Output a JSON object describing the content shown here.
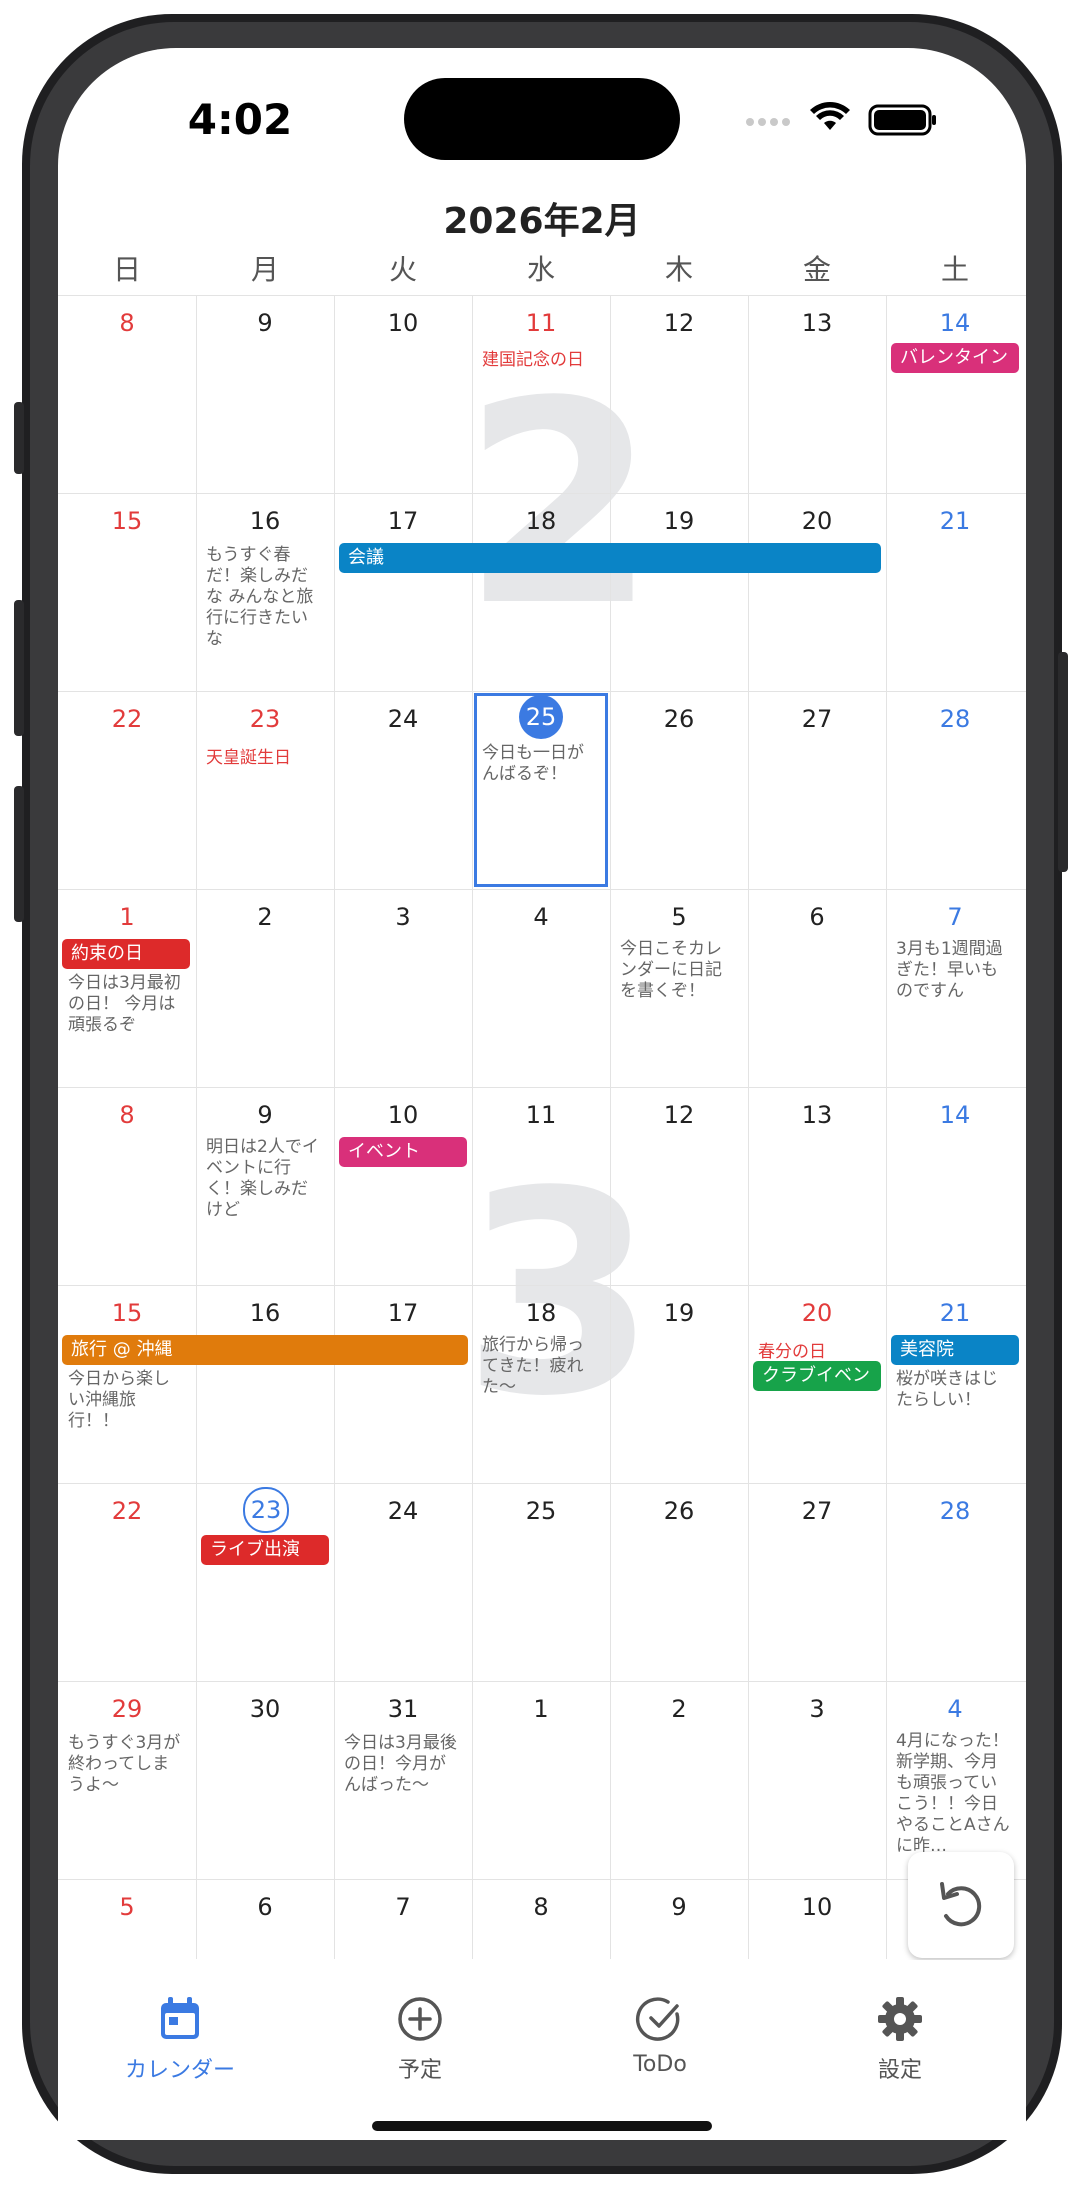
{
  "status": {
    "time": "4:02"
  },
  "calendar": {
    "month_title": "2026年2月",
    "weekdays": [
      "日",
      "月",
      "火",
      "水",
      "木",
      "金",
      "土"
    ],
    "watermarks": [
      "2",
      "3"
    ],
    "weeks": [
      [
        "8",
        "9",
        "10",
        "11",
        "12",
        "13",
        "14"
      ],
      [
        "15",
        "16",
        "17",
        "18",
        "19",
        "20",
        "21"
      ],
      [
        "22",
        "23",
        "24",
        "25",
        "26",
        "27",
        "28"
      ],
      [
        "1",
        "2",
        "3",
        "4",
        "5",
        "6",
        "7"
      ],
      [
        "8",
        "9",
        "10",
        "11",
        "12",
        "13",
        "14"
      ],
      [
        "15",
        "16",
        "17",
        "18",
        "19",
        "20",
        "21"
      ],
      [
        "22",
        "23",
        "24",
        "25",
        "26",
        "27",
        "28"
      ],
      [
        "29",
        "30",
        "31",
        "1",
        "2",
        "3",
        "4"
      ],
      [
        "5",
        "6",
        "7",
        "8",
        "9",
        "10",
        ""
      ]
    ],
    "holidays": {
      "kenkoku": "建国記念の日",
      "tenno": "天皇誕生日",
      "shunbun": "春分の日"
    },
    "events": {
      "valentine": "バレンタイン",
      "kaigi": "会議",
      "yakusoku": "約束の日",
      "event": "イベント",
      "okinawa": "旅行 @ 沖縄",
      "club": "クラブイベン",
      "biyoin": "美容院",
      "live": "ライブ出演"
    },
    "notes": {
      "feb16": "もうすぐ春だ！楽しみだな みんなと旅行に行きたいな",
      "feb25": "今日も一日がんばるぞ！",
      "mar1": "今日は3月最初の日！ 今月は頑張るぞ",
      "mar5": "今日こそカレンダーに日記を書くぞ！",
      "mar7": "3月も1週間過ぎた！早いものですん",
      "mar9": "明日は2人でイベントに行く！楽しみだけど",
      "mar15": "今日から楽しい沖縄旅行！！",
      "mar18": "旅行から帰ってきた！疲れた〜",
      "mar21": "桜が咲きはじたらしい！",
      "mar29": "もうすぐ3月が終わってしまうよ〜",
      "mar31": "今日は3月最後の日！今月がんばった〜",
      "apr4": "4月になった！新学期、今月も頑張っていこう！！今日やることAさんに昨…"
    }
  },
  "tabbar": {
    "calendar": "カレンダー",
    "schedule": "予定",
    "todo": "ToDo",
    "settings": "設定"
  },
  "colors": {
    "accent": "#3b7ae2",
    "sunday_holiday": "#e23b3b",
    "event_pink": "#d9307a",
    "event_blue": "#0a84c6",
    "event_red": "#dd2a2a",
    "event_orange": "#e07b0c",
    "event_green": "#17a34a"
  }
}
